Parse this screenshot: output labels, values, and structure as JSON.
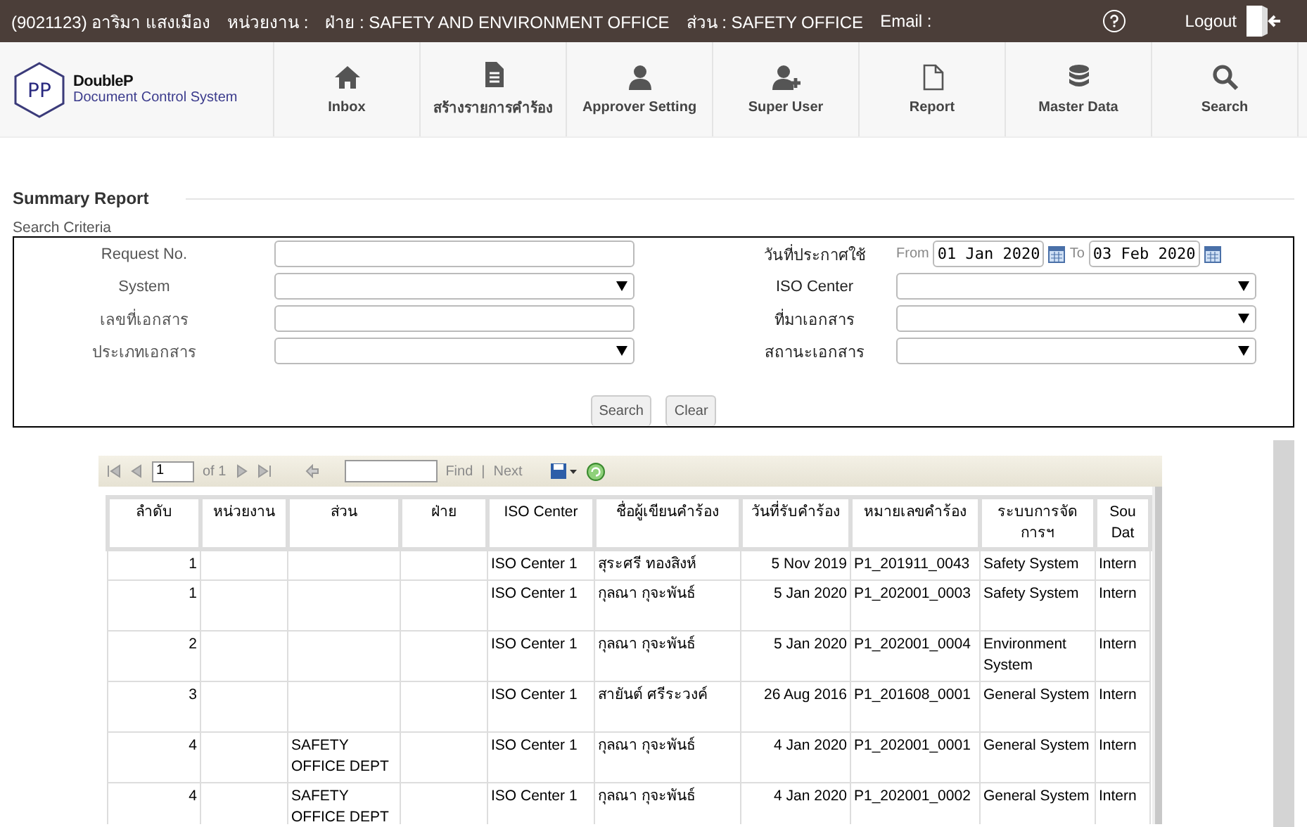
{
  "top_bar": {
    "user": "(9021123)  อาริมา แสงเมือง",
    "unit": "หน่วยงาน :",
    "division": "ฝ่าย : SAFETY AND ENVIRONMENT OFFICE",
    "section": "ส่วน : SAFETY OFFICE",
    "email": "Email :",
    "logout": "Logout"
  },
  "logo": {
    "mark": "PP",
    "brand": "DoubleP",
    "subtitle": "Document Control System"
  },
  "nav": [
    {
      "label": "Inbox"
    },
    {
      "label": "สร้างรายการคำร้อง"
    },
    {
      "label": "Approver Setting"
    },
    {
      "label": "Super User"
    },
    {
      "label": "Report"
    },
    {
      "label": "Master Data"
    },
    {
      "label": "Search"
    }
  ],
  "page_title": "Summary Report",
  "criteria_title": "Search Criteria",
  "fields": [
    {
      "label": "Request No.",
      "kind": "text"
    },
    {
      "label": "วันที่ประกาศใช้",
      "kind": "daterange",
      "from_label": "From",
      "from": "01 Jan 2020",
      "to_label": "To",
      "to": "03 Feb 2020"
    },
    {
      "label": "System",
      "kind": "select"
    },
    {
      "label": "ISO Center",
      "kind": "select"
    },
    {
      "label": "เลขที่เอกสาร",
      "kind": "text"
    },
    {
      "label": "ที่มาเอกสาร",
      "kind": "select"
    },
    {
      "label": "ประเภทเอกสาร",
      "kind": "select"
    },
    {
      "label": "สถานะเอกสาร",
      "kind": "select"
    }
  ],
  "buttons": [
    "Search",
    "Clear"
  ],
  "report_toolbar": {
    "page": "1",
    "of": "of 1",
    "find": "Find",
    "separator": "|",
    "next": "Next"
  },
  "table": {
    "columns": [
      "ลำดับ",
      "หน่วยงาน",
      "ส่วน",
      "ฝ่าย",
      "ISO Center",
      "ชื่อผู้เขียนคำร้อง",
      "วันที่รับคำร้อง",
      "หมายเลขคำร้อง",
      "ระบบการจัดการฯ",
      "Sou Dat"
    ],
    "rows": [
      [
        "1",
        "",
        "",
        "",
        "ISO Center 1",
        "สุระศรี ทองสิงห์",
        "5 Nov 2019",
        "P1_201911_0043",
        "Safety System",
        "Intern"
      ],
      [
        "1",
        "",
        "",
        "",
        "ISO Center 1",
        "กุลณา กุจะพันธ์",
        "5 Jan 2020",
        "P1_202001_0003",
        "Safety System",
        "Intern"
      ],
      [
        "2",
        "",
        "",
        "",
        "ISO Center 1",
        "กุลณา กุจะพันธ์",
        "5 Jan 2020",
        "P1_202001_0004",
        "Environment System",
        "Intern"
      ],
      [
        "3",
        "",
        "",
        "",
        "ISO Center 1",
        "สายันต์ ศรีระวงค์",
        "26 Aug 2016",
        "P1_201608_0001",
        "General System",
        "Intern"
      ],
      [
        "4",
        "",
        "SAFETY OFFICE DEPT",
        "",
        "ISO Center 1",
        "กุลณา กุจะพันธ์",
        "4 Jan 2020",
        "P1_202001_0001",
        "General System",
        "Intern"
      ],
      [
        "4",
        "",
        "SAFETY OFFICE DEPT",
        "",
        "ISO Center 1",
        "กุลณา กุจะพันธ์",
        "4 Jan 2020",
        "P1_202001_0002",
        "General System",
        "Intern"
      ]
    ]
  }
}
